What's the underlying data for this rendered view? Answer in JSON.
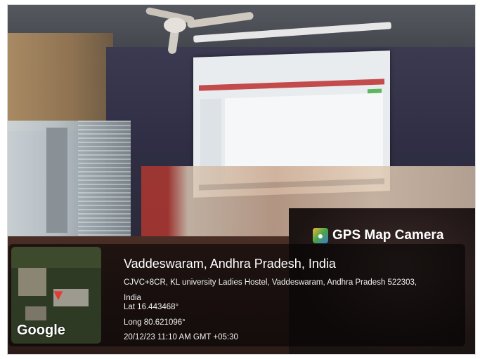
{
  "badge": {
    "icon": "map-pin-icon",
    "title": "GPS Map Camera"
  },
  "location": {
    "title": "Vaddeswaram, Andhra Pradesh, India",
    "address_line1": "CJVC+8CR, KL university Ladies Hostel, Vaddeswaram, Andhra Pradesh 522303,",
    "address_line2": "India",
    "lat": "Lat 16.443468°",
    "long": "Long 80.621096°",
    "datetime": "20/12/23 11:10 AM GMT +05:30"
  },
  "map": {
    "brand": "Google",
    "pin_icon": "location-pin-icon"
  },
  "colors": {
    "badge_gradient": [
      "#f2b736",
      "#47a447",
      "#3b7dd8"
    ],
    "pin": "#e53935",
    "screen_header": "#c44b4b"
  }
}
